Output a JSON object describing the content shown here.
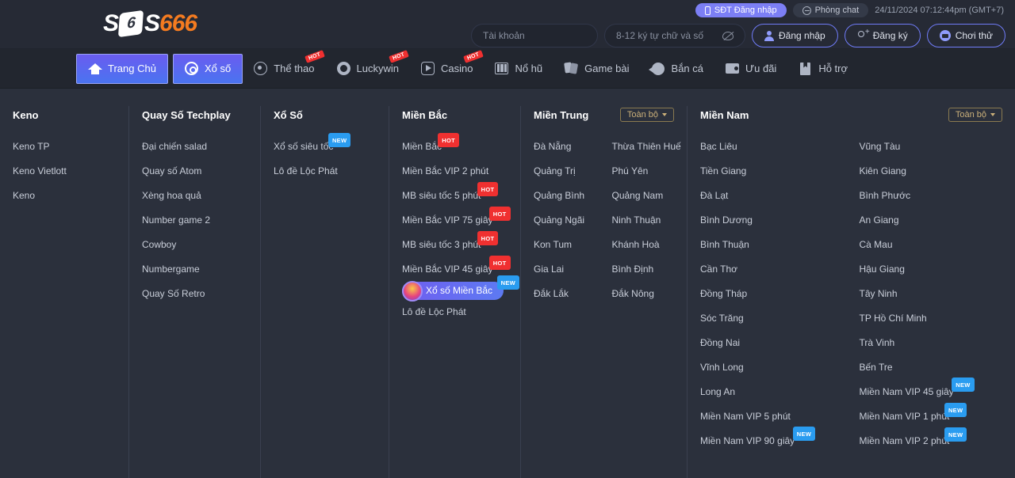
{
  "brand": {
    "s1": "S",
    "dice": "6",
    "s2": "S",
    "num": "666"
  },
  "topbar": {
    "otp_login": "SĐT Đăng nhập",
    "chat_room": "Phòng chat",
    "timestamp": "24/11/2024 07:12:44pm (GMT+7)",
    "username_placeholder": "Tài khoản",
    "username_value": "",
    "password_placeholder": "8-12 ký tự chữ và số",
    "password_value": "",
    "login": "Đăng nhập",
    "register": "Đăng ký",
    "trial": "Chơi thử"
  },
  "nav": [
    {
      "label": "Trang Chủ",
      "icon": "home-icon",
      "active": true,
      "hot": false
    },
    {
      "label": "Xổ số",
      "icon": "target-icon",
      "active": true,
      "hot": false
    },
    {
      "label": "Thể thao",
      "icon": "soccer-icon",
      "active": false,
      "hot": true,
      "hot_label": "HOT"
    },
    {
      "label": "Luckywin",
      "icon": "chip-icon",
      "active": false,
      "hot": true,
      "hot_label": "HOT"
    },
    {
      "label": "Casino",
      "icon": "play-icon",
      "active": false,
      "hot": true,
      "hot_label": "HOT"
    },
    {
      "label": "Nổ hũ",
      "icon": "slot-icon",
      "active": false,
      "hot": false
    },
    {
      "label": "Game bài",
      "icon": "cards-icon",
      "active": false,
      "hot": false
    },
    {
      "label": "Bắn cá",
      "icon": "fish-icon",
      "active": false,
      "hot": false
    },
    {
      "label": "Ưu đãi",
      "icon": "gift-icon",
      "active": false,
      "hot": false
    },
    {
      "label": "Hỗ trợ",
      "icon": "book-icon",
      "active": false,
      "hot": false
    }
  ],
  "panel": {
    "all_label": "Toàn bộ",
    "columns": [
      {
        "title": "Keno",
        "items": [
          {
            "label": "Keno TP"
          },
          {
            "label": "Keno Vietlott"
          },
          {
            "label": "Keno"
          }
        ]
      },
      {
        "title": "Quay Số Techplay",
        "items": [
          {
            "label": "Đại chiến salad"
          },
          {
            "label": "Quay số Atom"
          },
          {
            "label": "Xèng hoa quả"
          },
          {
            "label": "Number game 2"
          },
          {
            "label": "Cowboy"
          },
          {
            "label": "Numbergame"
          },
          {
            "label": "Quay Số Retro"
          }
        ]
      },
      {
        "title": "Xổ Số",
        "items": [
          {
            "label": "Xổ số siêu tốc",
            "badge": "NEW",
            "badge_type": "new"
          },
          {
            "label": "Lô đề Lộc Phát"
          }
        ]
      },
      {
        "title": "Miền Bắc",
        "items": [
          {
            "label": "Miền Bắc",
            "badge": "HOT",
            "badge_type": "hot"
          },
          {
            "label": "Miền Bắc VIP 2 phút"
          },
          {
            "label": "MB siêu tốc 5 phút",
            "badge": "HOT",
            "badge_type": "hot"
          },
          {
            "label": "Miền Bắc VIP 75 giây",
            "badge": "HOT",
            "badge_type": "hot"
          },
          {
            "label": "MB siêu tốc 3 phút",
            "badge": "HOT",
            "badge_type": "hot"
          },
          {
            "label": "Miền Bắc VIP 45 giây",
            "badge": "HOT",
            "badge_type": "hot"
          },
          {
            "label": "Xổ số Miền Bắc",
            "badge": "NEW",
            "badge_type": "new",
            "pill": true,
            "icon": "lottery-ball-icon"
          },
          {
            "label": "Lô đề Lộc Phát"
          }
        ]
      },
      {
        "title": "Miền Trung",
        "has_all": true,
        "two_col": true,
        "items": [
          {
            "label": "Đà Nẵng"
          },
          {
            "label": "Thừa Thiên Huế"
          },
          {
            "label": "Quảng Trị"
          },
          {
            "label": "Phú Yên"
          },
          {
            "label": "Quảng Bình"
          },
          {
            "label": "Quảng Nam"
          },
          {
            "label": "Quảng Ngãi"
          },
          {
            "label": "Ninh Thuận"
          },
          {
            "label": "Kon Tum"
          },
          {
            "label": "Khánh Hoà"
          },
          {
            "label": "Gia Lai"
          },
          {
            "label": "Bình Định"
          },
          {
            "label": "Đắk Lắk"
          },
          {
            "label": "Đắk Nông"
          }
        ]
      },
      {
        "title": "Miền Nam",
        "has_all": true,
        "two_col": true,
        "items": [
          {
            "label": "Bạc Liêu"
          },
          {
            "label": "Vũng Tàu"
          },
          {
            "label": "Tiền Giang"
          },
          {
            "label": "Kiên Giang"
          },
          {
            "label": "Đà Lạt"
          },
          {
            "label": "Bình Phước"
          },
          {
            "label": "Bình Dương"
          },
          {
            "label": "An Giang"
          },
          {
            "label": "Bình Thuận"
          },
          {
            "label": "Cà Mau"
          },
          {
            "label": "Cần Thơ"
          },
          {
            "label": "Hậu Giang"
          },
          {
            "label": "Đồng Tháp"
          },
          {
            "label": "Tây Ninh"
          },
          {
            "label": "Sóc Trăng"
          },
          {
            "label": "TP Hồ Chí Minh"
          },
          {
            "label": "Đồng Nai"
          },
          {
            "label": "Trà Vinh"
          },
          {
            "label": "Vĩnh Long"
          },
          {
            "label": "Bến Tre"
          },
          {
            "label": "Long An"
          },
          {
            "label": "Miền Nam VIP 45 giây",
            "badge": "NEW",
            "badge_type": "new",
            "wrap2": true
          },
          {
            "label": "Miền Nam VIP 5 phút"
          },
          {
            "label": "Miền Nam VIP 1 phút",
            "badge": "NEW",
            "badge_type": "new"
          },
          {
            "label": "Miền Nam VIP 90 giây",
            "badge": "NEW",
            "badge_type": "new",
            "wrap2": true
          },
          {
            "label": "Miền Nam VIP 2 phút",
            "badge": "NEW",
            "badge_type": "new"
          }
        ]
      }
    ]
  },
  "colors": {
    "bg": "#2b303c",
    "topbar_bg": "#262a35",
    "nav_bg": "#22262f",
    "accent_purple": "#6a5cf0",
    "accent_blue": "#4a74f0",
    "hot_red": "#f03030",
    "new_blue": "#2a9cf0",
    "gold": "#cbb07a",
    "brand_orange": "#f47b20"
  }
}
